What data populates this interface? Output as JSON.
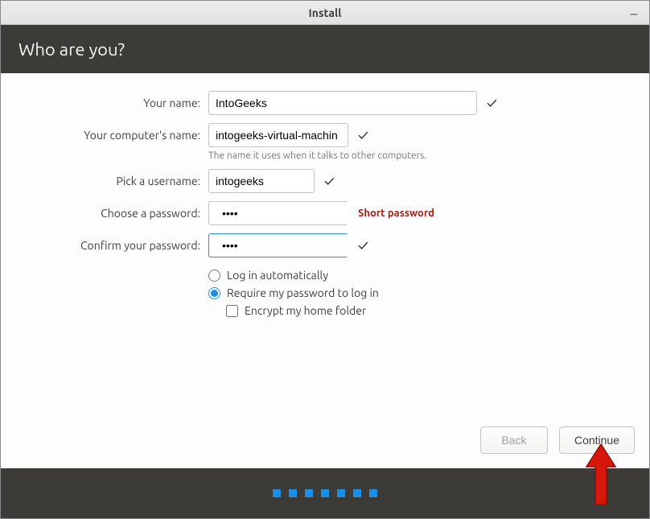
{
  "titlebar": {
    "title": "Install"
  },
  "header": {
    "title": "Who are you?"
  },
  "form": {
    "name_label": "Your name:",
    "name_value": "IntoGeeks",
    "computer_label": "Your computer's name:",
    "computer_value": "intogeeks-virtual-machin",
    "computer_hint": "The name it uses when it talks to other computers.",
    "username_label": "Pick a username:",
    "username_value": "intogeeks",
    "password_label": "Choose a password:",
    "password_value": "••••",
    "password_warning": "Short password",
    "confirm_label": "Confirm your password:",
    "confirm_value": "••••",
    "option_auto": "Log in automatically",
    "option_require": "Require my password to log in",
    "option_encrypt": "Encrypt my home folder"
  },
  "buttons": {
    "back": "Back",
    "continue": "Continue"
  }
}
